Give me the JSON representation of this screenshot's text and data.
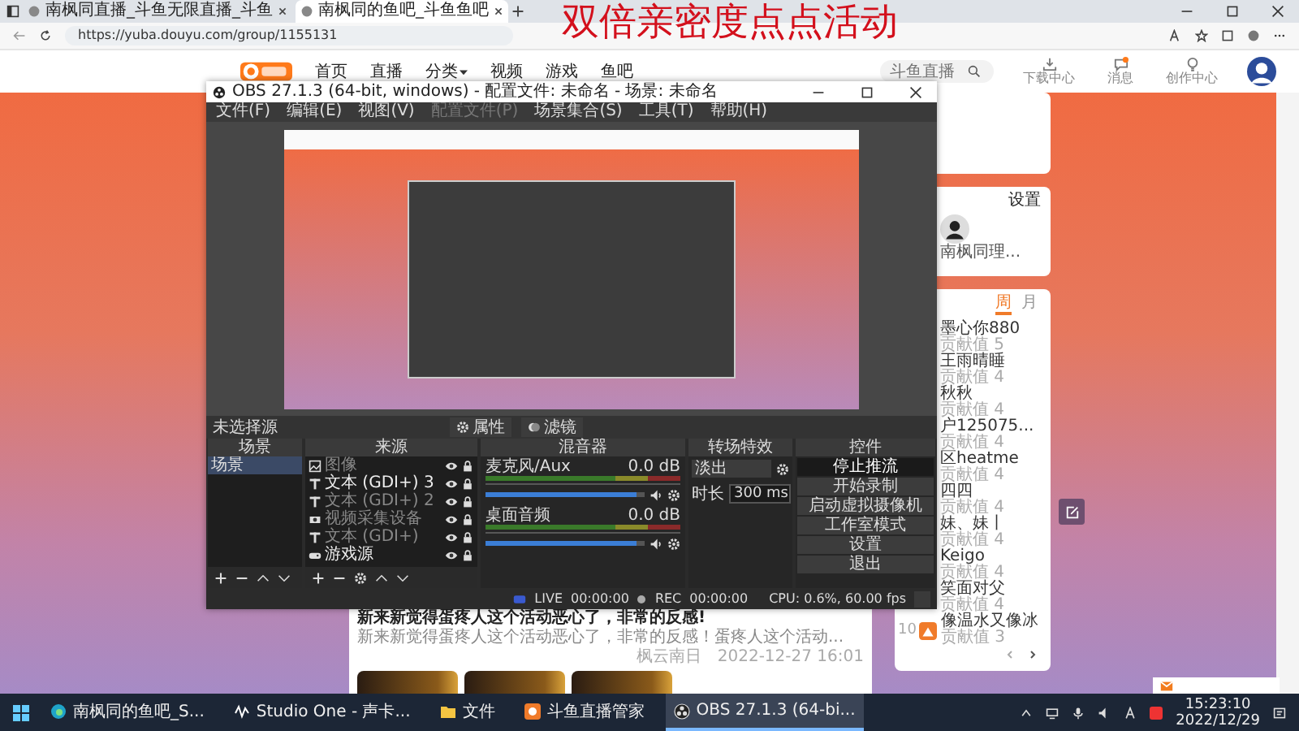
{
  "browser": {
    "tabs": [
      {
        "title": "南枫同直播_斗鱼无限直播_斗鱼",
        "selected": false
      },
      {
        "title": "南枫同的鱼吧_斗鱼鱼吧",
        "selected": true
      }
    ],
    "url": "https://yuba.douyu.com/group/1155131"
  },
  "overlay_caption": "双倍亲密度点点活动",
  "site": {
    "nav": [
      {
        "label": "首页",
        "dropdown": false
      },
      {
        "label": "直播",
        "dropdown": false
      },
      {
        "label": "分类",
        "dropdown": true
      },
      {
        "label": "视频",
        "dropdown": false
      },
      {
        "label": "游戏",
        "dropdown": false
      },
      {
        "label": "鱼吧",
        "dropdown": false
      }
    ],
    "search": {
      "placeholder": "斗鱼直播"
    },
    "actions": [
      {
        "label": "下载中心",
        "kind": "download"
      },
      {
        "label": "消息",
        "kind": "message"
      },
      {
        "label": "创作中心",
        "kind": "create"
      }
    ]
  },
  "obs": {
    "title": "OBS 27.1.3 (64-bit, windows) - 配置文件: 未命名 - 场景: 未命名",
    "menu": [
      {
        "label": "文件(F)",
        "disabled": false
      },
      {
        "label": "编辑(E)",
        "disabled": false
      },
      {
        "label": "视图(V)",
        "disabled": false
      },
      {
        "label": "配置文件(P)",
        "disabled": true
      },
      {
        "label": "场景集合(S)",
        "disabled": false
      },
      {
        "label": "工具(T)",
        "disabled": false
      },
      {
        "label": "帮助(H)",
        "disabled": false
      }
    ],
    "no_source_label": "未选择源",
    "source_buttons": [
      {
        "label": "属性",
        "kind": "properties"
      },
      {
        "label": "滤镜",
        "kind": "filters"
      }
    ],
    "scenes": {
      "title": "场景",
      "items": [
        {
          "label": "场景",
          "selected": true
        }
      ]
    },
    "sources": {
      "title": "来源",
      "items": [
        {
          "label": "图像",
          "kind": "image",
          "dimmed": true
        },
        {
          "label": "文本 (GDI+) 3",
          "kind": "text",
          "dimmed": false
        },
        {
          "label": "文本 (GDI+) 2",
          "kind": "text",
          "dimmed": true
        },
        {
          "label": "视频采集设备",
          "kind": "camera",
          "dimmed": true
        },
        {
          "label": "文本 (GDI+)",
          "kind": "text",
          "dimmed": true
        },
        {
          "label": "游戏源",
          "kind": "game",
          "dimmed": false
        }
      ]
    },
    "mixer": {
      "title": "混音器",
      "channels": [
        {
          "name": "麦克风/Aux",
          "reading": "0.0 dB",
          "level": 0.95
        },
        {
          "name": "桌面音频",
          "reading": "0.0 dB",
          "level": 0.95
        }
      ]
    },
    "transitions": {
      "title": "转场特效",
      "transition": "淡出",
      "duration_label": "时长",
      "duration": "300 ms"
    },
    "controls": {
      "title": "控件",
      "buttons": [
        {
          "label": "停止推流",
          "active": true
        },
        {
          "label": "开始录制",
          "active": false
        },
        {
          "label": "启动虚拟摄像机",
          "active": false
        },
        {
          "label": "工作室模式",
          "active": false
        },
        {
          "label": "设置",
          "active": false
        },
        {
          "label": "退出",
          "active": false
        }
      ]
    },
    "status": {
      "live_label": "LIVE",
      "live_time": "00:00:00",
      "rec_label": "REC",
      "rec_time": "00:00:00",
      "cpu": "CPU: 0.6%, 60.00 fps"
    }
  },
  "profile_card": {
    "settings": "设置",
    "name": "南枫同理..."
  },
  "ranking": {
    "tabs": [
      {
        "label": "周",
        "selected": true
      },
      {
        "label": "月",
        "selected": false
      }
    ],
    "items": [
      {
        "name": "墨心你880",
        "score": "贡献值 5"
      },
      {
        "name": "王雨晴睡",
        "score": "贡献值 4"
      },
      {
        "name": "秋秋",
        "score": "贡献值 4"
      },
      {
        "name": "户125075...",
        "score": "贡献值 4"
      },
      {
        "name": "区heatme",
        "score": "贡献值 4"
      },
      {
        "name": "四四",
        "score": "贡献值 4"
      },
      {
        "name": "妹、妹丨",
        "score": "贡献值 4"
      },
      {
        "name": "Keigo",
        "score": "贡献值 4"
      },
      {
        "name": "笑面对父",
        "score": "贡献值 4"
      },
      {
        "rank": "10",
        "name": "像温水又像冰",
        "score": "贡献值 3"
      }
    ]
  },
  "post": {
    "title": "新来新觉得蛋疼人这个活动恶心了，非常的反感!",
    "excerpt": "新来新觉得蛋疼人这个活动恶心了，非常的反感！蛋疼人这个活动...",
    "author": "枫云南日",
    "date": "2022-12-27 16:01"
  },
  "taskbar": {
    "items": [
      {
        "label": "南枫同的鱼吧_S...",
        "kind": "edge",
        "selected": false
      },
      {
        "label": "Studio One - 声卡...",
        "kind": "studio",
        "selected": false
      },
      {
        "label": "文件",
        "kind": "folder",
        "selected": false
      },
      {
        "label": "斗鱼直播管家",
        "kind": "douyu",
        "selected": false
      },
      {
        "label": "OBS 27.1.3 (64-bi...",
        "kind": "obs",
        "selected": true
      }
    ],
    "time": "15:23:10",
    "date": "2022/12/29"
  }
}
